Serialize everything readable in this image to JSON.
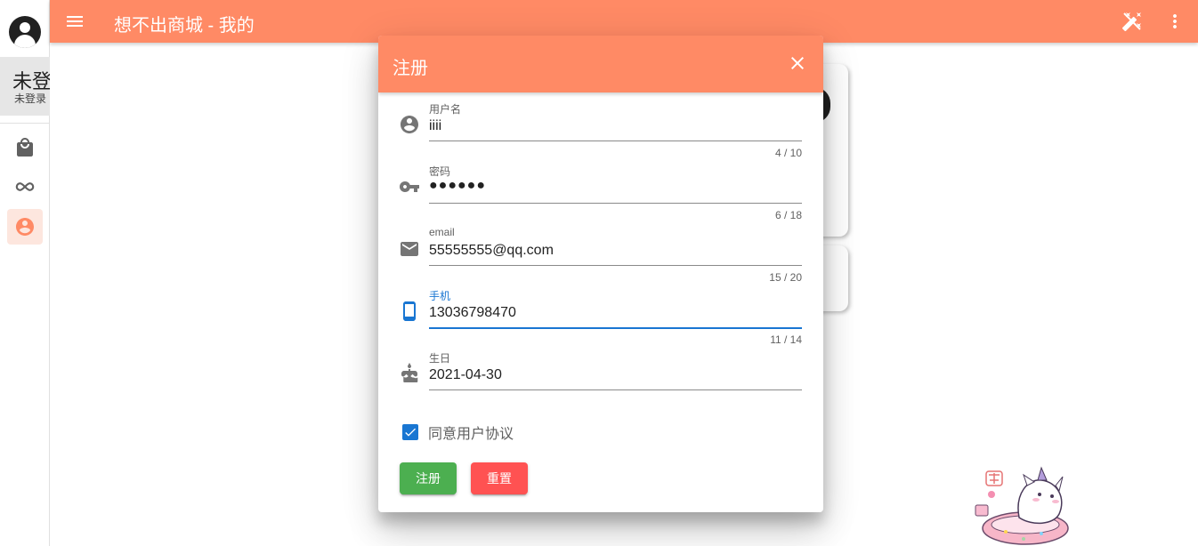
{
  "app": {
    "title": "想不出商城 - 我的"
  },
  "sidebar": {
    "user_name": "未登录",
    "user_sub": "未登录",
    "items": [
      {
        "name": "shopping-bag-icon"
      },
      {
        "name": "infinity-icon"
      },
      {
        "name": "account-circle-icon",
        "active": true
      }
    ]
  },
  "dialog": {
    "title": "注册",
    "fields": [
      {
        "label": "用户名",
        "value": "iiii",
        "counter": "4 / 10",
        "icon": "account-circle-icon"
      },
      {
        "label": "密码",
        "value": "●●●●●●",
        "counter": "6 / 18",
        "icon": "key-icon"
      },
      {
        "label": "email",
        "value": "55555555@qq.com",
        "counter": "15 / 20",
        "icon": "email-icon"
      },
      {
        "label": "手机",
        "value": "13036798470",
        "counter": "11 / 14",
        "icon": "cellphone-icon",
        "focused": true
      },
      {
        "label": "生日",
        "value": "2021-04-30",
        "icon": "cake-icon"
      }
    ],
    "agree_label": "同意用户协议",
    "agree_checked": true,
    "submit_label": "注册",
    "reset_label": "重置"
  },
  "colors": {
    "primary": "#ff8a65",
    "focus": "#1976d2",
    "submit": "#4caf50",
    "reset": "#ff5252"
  }
}
